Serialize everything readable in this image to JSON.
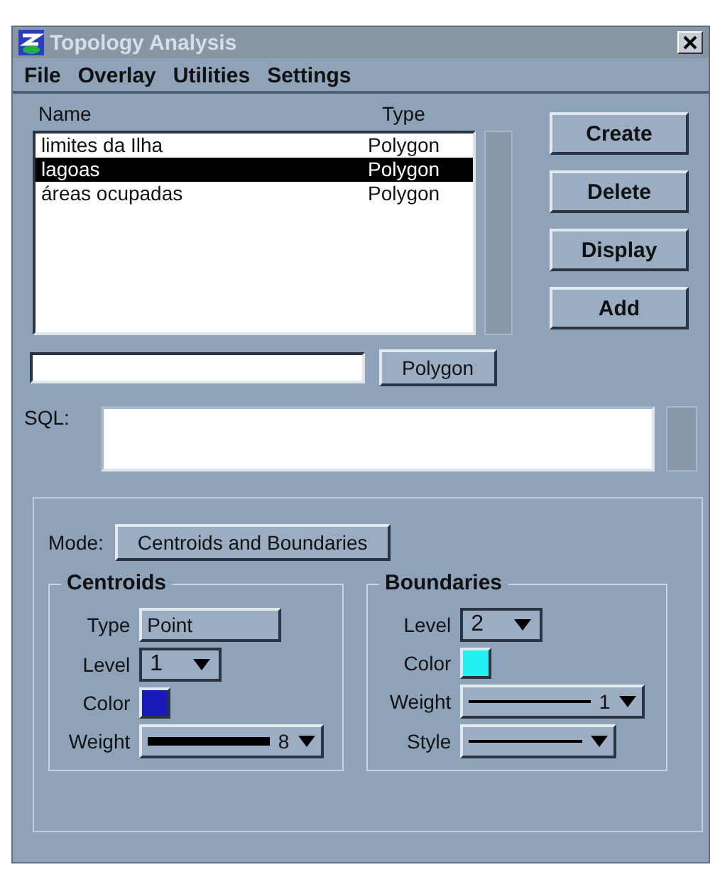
{
  "window": {
    "title": "Topology Analysis"
  },
  "menu": [
    "File",
    "Overlay",
    "Utilities",
    "Settings"
  ],
  "list": {
    "columns": [
      "Name",
      "Type"
    ],
    "rows": [
      {
        "name": "limites da Ilha",
        "type": "Polygon",
        "selected": false
      },
      {
        "name": "lagoas",
        "type": "Polygon",
        "selected": true
      },
      {
        "name": "áreas ocupadas",
        "type": "Polygon",
        "selected": false
      }
    ]
  },
  "buttons": [
    "Create",
    "Delete",
    "Display",
    "Add"
  ],
  "type_button": "Polygon",
  "sql": {
    "label": "SQL:"
  },
  "mode": {
    "label": "Mode:",
    "value": "Centroids and Boundaries"
  },
  "centroids": {
    "title": "Centroids",
    "type_label": "Type",
    "type_value": "Point",
    "level_label": "Level",
    "level_value": "1",
    "color_label": "Color",
    "color": "#1a1ab8",
    "weight_label": "Weight",
    "weight_value": "8"
  },
  "boundaries": {
    "title": "Boundaries",
    "level_label": "Level",
    "level_value": "2",
    "color_label": "Color",
    "color": "#20f0f0",
    "weight_label": "Weight",
    "weight_value": "1",
    "style_label": "Style"
  }
}
